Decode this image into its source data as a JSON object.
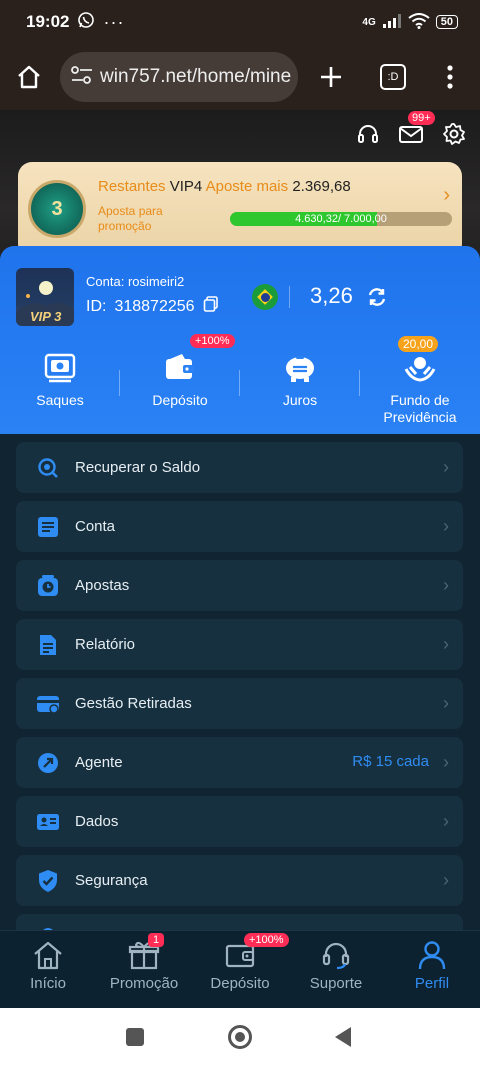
{
  "status_bar": {
    "time": "19:02",
    "battery": "50",
    "network": "4G"
  },
  "browser": {
    "url": "win757.net/home/mine",
    "tab_count_icon": ":D"
  },
  "header": {
    "notification_badge": "99+"
  },
  "vip": {
    "level_number": "3",
    "line_prefix": "Restantes",
    "level_name": "VIP4",
    "line_mid": "Aposte mais",
    "remaining": "2.369,68",
    "sub_label": "Aposta para promoção",
    "progress_text": "4.630,32/ 7.000,00",
    "progress_fraction": 0.66
  },
  "account": {
    "label": "Conta:",
    "username": "rosimeiri2",
    "id_label": "ID:",
    "id": "318872256",
    "avatar_badge": "VIP 3",
    "balance": "3,26"
  },
  "actions": [
    {
      "label": "Saques",
      "tag": ""
    },
    {
      "label": "Depósito",
      "tag": "+100%"
    },
    {
      "label": "Juros",
      "tag": ""
    },
    {
      "label": "Fundo de Previdência",
      "tag": "20,00"
    }
  ],
  "menu": [
    {
      "label": "Recuperar o Saldo",
      "icon": "search-coin-icon",
      "extra": ""
    },
    {
      "label": "Conta",
      "icon": "list-icon",
      "extra": ""
    },
    {
      "label": "Apostas",
      "icon": "clock-icon",
      "extra": ""
    },
    {
      "label": "Relatório",
      "icon": "document-icon",
      "extra": ""
    },
    {
      "label": "Gestão Retiradas",
      "icon": "card-icon",
      "extra": ""
    },
    {
      "label": "Agente",
      "icon": "share-icon",
      "extra": "R$ 15 cada"
    },
    {
      "label": "Dados",
      "icon": "id-card-icon",
      "extra": ""
    },
    {
      "label": "Segurança",
      "icon": "shield-icon",
      "extra": ""
    }
  ],
  "tabs": [
    {
      "label": "Início",
      "badge": ""
    },
    {
      "label": "Promoção",
      "badge": "1"
    },
    {
      "label": "Depósito",
      "badge": "+100%"
    },
    {
      "label": "Suporte",
      "badge": ""
    },
    {
      "label": "Perfil",
      "badge": ""
    }
  ],
  "colors": {
    "accent": "#2f8cf2",
    "panel": "#1f73ec",
    "tag_red": "#ff2d55",
    "tag_orange": "#f7a21b",
    "vip_orange": "#e88c1a"
  }
}
